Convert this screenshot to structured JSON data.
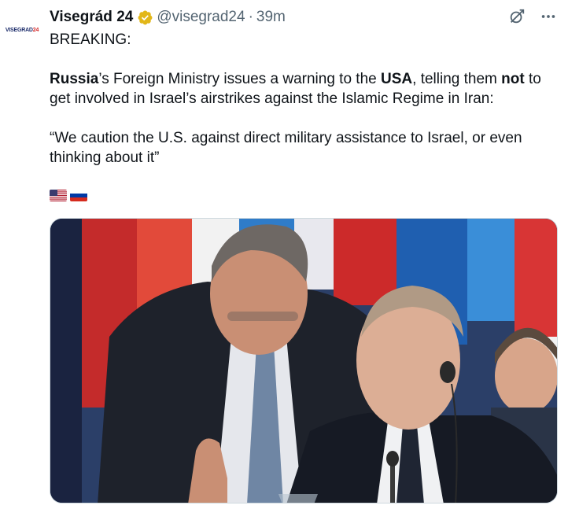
{
  "account": {
    "avatar_text": "VISEGRAD",
    "avatar_text_accent": "24",
    "name": "Visegrád 24",
    "handle": "@visegrad24",
    "separator": "·",
    "time": "39m",
    "verified_icon": "verified-gold-badge-icon"
  },
  "actions": {
    "grok_icon": "grok-icon",
    "more_icon": "more-options-icon"
  },
  "tweet": {
    "line1": "BREAKING:",
    "para2_part1": "Russia",
    "para2_part2": "’s Foreign Ministry issues a warning to the ",
    "para2_part3": "USA",
    "para2_part4": ", telling them ",
    "para2_part5": "not",
    "para2_part6": " to get involved in Israel’s airstrikes against the Islamic Regime in Iran:",
    "quote": "“We caution the U.S. against direct military assistance to Israel, or even thinking about it”",
    "flags": [
      "us-flag-icon",
      "russia-flag-icon"
    ]
  },
  "media": {
    "type": "photo",
    "subject": "two-men-conference-photo"
  },
  "colors": {
    "text": "#0f1419",
    "secondary": "#536471",
    "verified_gold": "#e2b719"
  }
}
